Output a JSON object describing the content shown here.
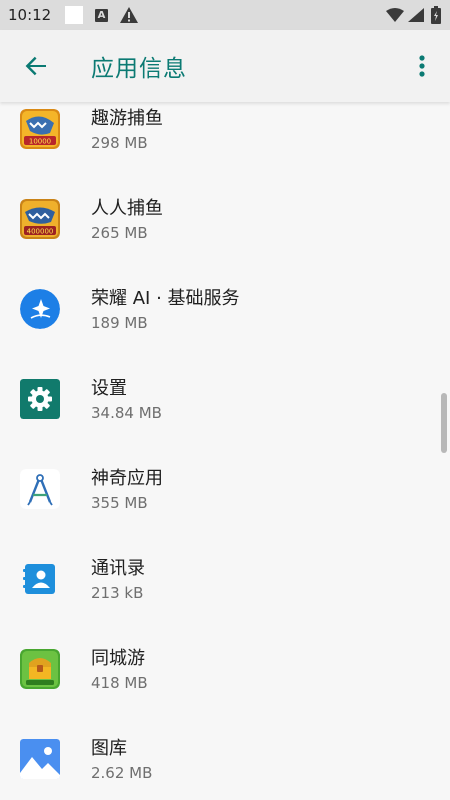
{
  "status_bar": {
    "time": "10:12",
    "a_icon_letter": "A"
  },
  "app_bar": {
    "title": "应用信息",
    "back_icon": "arrow-left-icon",
    "more_icon": "more-vertical-icon",
    "accent_color": "#0b7a73"
  },
  "apps": [
    {
      "name": "趣游捕鱼",
      "size": "298 MB",
      "icon": "fish-game-icon"
    },
    {
      "name": "人人捕鱼",
      "size": "265 MB",
      "icon": "fish-game-icon"
    },
    {
      "name": "荣耀 AI · 基础服务",
      "size": "189 MB",
      "icon": "ai-sparkle-icon"
    },
    {
      "name": "设置",
      "size": "34.84 MB",
      "icon": "gear-icon"
    },
    {
      "name": "神奇应用",
      "size": "355 MB",
      "icon": "android-studio-icon"
    },
    {
      "name": "通讯录",
      "size": "213 kB",
      "icon": "contacts-icon"
    },
    {
      "name": "同城游",
      "size": "418 MB",
      "icon": "chest-game-icon"
    },
    {
      "name": "图库",
      "size": "2.62 MB",
      "icon": "gallery-icon"
    }
  ]
}
